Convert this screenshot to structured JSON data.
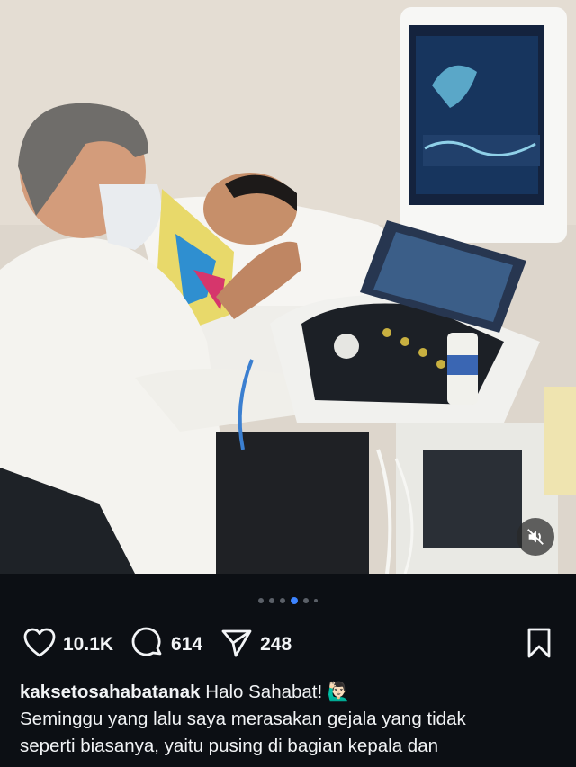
{
  "post": {
    "media_description": "ultrasound-examination-photo",
    "carousel": {
      "total": 6,
      "active_index": 3
    },
    "mute_icon": "speaker-muted-icon"
  },
  "actions": {
    "likes": "10.1K",
    "comments": "614",
    "shares": "248"
  },
  "caption": {
    "username": "kaksetosahabatanak",
    "greeting": "Halo Sahabat!",
    "emoji": "🙋🏻‍♂️",
    "line2": "Seminggu yang lalu saya merasakan gejala yang tidak",
    "line3": "seperti biasanya, yaitu pusing di bagian kepala dan"
  },
  "colors": {
    "background": "#0c0f14",
    "accent": "#3d84ff",
    "text": "#f3f5f7"
  }
}
